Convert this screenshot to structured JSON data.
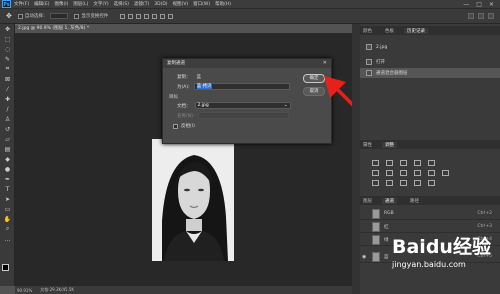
{
  "app": {
    "logo": "Ps"
  },
  "menubar": {
    "items": [
      "文件(F)",
      "编辑(E)",
      "图像(I)",
      "图层(L)",
      "文字(Y)",
      "选择(S)",
      "滤镜(T)",
      "3D(D)",
      "视图(V)",
      "窗口(W)",
      "帮助(H)"
    ],
    "window_controls": [
      "—",
      "□",
      "✕"
    ]
  },
  "optionsbar": {
    "auto_select_label": "自动选择：",
    "show_transform_label": "显示变换控件"
  },
  "document": {
    "tab_title": "2.jpg @ 90.9% (图层 1, 灰色/8) *",
    "status_zoom": "90.91%",
    "status_doc": "文档:29.3K/45.5K"
  },
  "dialog": {
    "title": "复制通道",
    "copy_label": "复制：",
    "copy_value": "蓝",
    "as_label": "为(A):",
    "as_value": "蓝 拷贝",
    "target_label": "目标",
    "doc_label": "文档：",
    "doc_value": "2.jpg",
    "name_label": "名称(N):",
    "invert_label": "反相(I)",
    "ok_button": "确定",
    "cancel_button": "取消"
  },
  "right_panel": {
    "top_tabs": [
      "颜色",
      "色板",
      "历史记录"
    ],
    "history": {
      "snapshot": "2.jpg",
      "items": [
        "打开",
        "通道混合器图层"
      ]
    },
    "mid_tabs": [
      "属性",
      "调整"
    ],
    "layers_tabs": [
      "图层",
      "通道",
      "路径"
    ],
    "channels": [
      {
        "name": "RGB",
        "key": "Ctrl+2"
      },
      {
        "name": "红",
        "key": "Ctrl+3"
      },
      {
        "name": "绿",
        "key": "Ctrl+4"
      },
      {
        "name": "蓝",
        "key": "Ctrl+5"
      }
    ]
  },
  "watermark": {
    "logo": "Baidu经验",
    "url": "jingyan.baidu.com"
  },
  "colors": {
    "arrow": "#e8201a",
    "selection": "#2c6fd1"
  }
}
